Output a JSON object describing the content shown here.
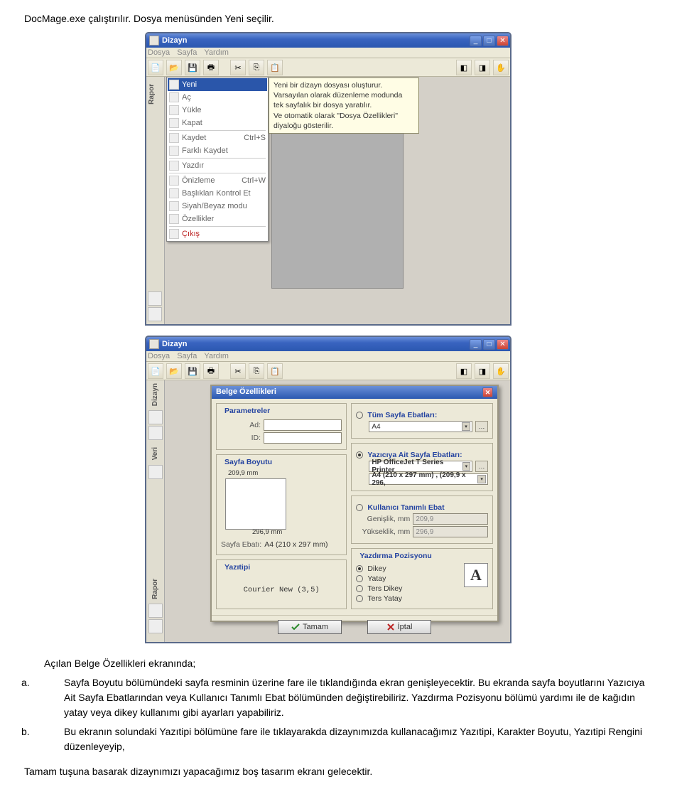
{
  "doc": {
    "intro": "DocMage.exe çalıştırılır. Dosya menüsünden Yeni seçilir.",
    "after1": "Açılan Belge Özellikleri ekranında;",
    "a": "Sayfa Boyutu bölümündeki sayfa resminin üzerine fare ile tıklandığında ekran genişleyecektir. Bu ekranda sayfa boyutlarını Yazıcıya Ait Sayfa Ebatlarından veya Kullanıcı Tanımlı Ebat bölümünden değiştirebiliriz. Yazdırma Pozisyonu bölümü yardımı ile de kağıdın yatay veya dikey kullanımı gibi ayarları yapabiliriz.",
    "b": "Bu ekranın solundaki Yazıtipi bölümüne fare ile tıklayarakda dizaynımızda kullanacağımız Yazıtipi, Karakter Boyutu, Yazıtipi Rengini düzenleyeyip,",
    "last": "Tamam tuşuna basarak dizaynımızı yapacağımız boş tasarım ekranı gelecektir."
  },
  "app": {
    "title": "Dizayn",
    "menus": {
      "dosya": "Dosya",
      "sayfa": "Sayfa",
      "yardim": "Yardım"
    },
    "side": {
      "rapor": "Rapor",
      "dizayn": "Dizayn",
      "veri": "Veri"
    }
  },
  "filemenu": {
    "yeni": "Yeni",
    "ac": "Aç",
    "yukle": "Yükle",
    "kapat": "Kapat",
    "kaydet": "Kaydet",
    "kaydet_sc": "Ctrl+S",
    "farkli": "Farklı Kaydet",
    "yazdir": "Yazdır",
    "onizleme": "Önizleme",
    "onizleme_sc": "Ctrl+W",
    "basliklari": "Başlıkları Kontrol Et",
    "siyah": "Siyah/Beyaz modu",
    "ozellikler": "Özellikler",
    "cikis": "Çıkış"
  },
  "tooltip": {
    "l1": "Yeni bir dizayn dosyası oluşturur.",
    "l2": "Varsayılan olarak düzenleme modunda",
    "l3": "tek sayfalık bir dosya yaratılır.",
    "l4": "Ve otomatik olarak \"Dosya Özellikleri\" diyaloğu gösterilir."
  },
  "dialog": {
    "title": "Belge Özellikleri",
    "params": {
      "title": "Parametreler",
      "ad_lab": "Ad:",
      "id_lab": "ID:"
    },
    "sayfa": {
      "title": "Sayfa Boyutu",
      "w": "209,9 mm",
      "h": "296,9 mm",
      "info_lab": "Sayfa Ebatı:",
      "info_val": "A4 (210 x 297 mm)"
    },
    "yazitipi": {
      "title": "Yazıtipi",
      "font": "Courier New (3,5)"
    },
    "tum": {
      "title": "Tüm Sayfa Ebatları:",
      "combo": "A4"
    },
    "yazici": {
      "title": "Yazıcıya Ait Sayfa Ebatları:",
      "printer": "HP OfficeJet T Series Printer",
      "size": "A4 (210 x 297 mm) ,   (209,9 x 296,"
    },
    "kul": {
      "title": "Kullanıcı Tanımlı Ebat",
      "w_lab": "Genişlik, mm",
      "w_val": "209,9",
      "h_lab": "Yükseklik, mm",
      "h_val": "296,9"
    },
    "poz": {
      "title": "Yazdırma Pozisyonu",
      "opt1": "Dikey",
      "opt2": "Yatay",
      "opt3": "Ters Dikey",
      "opt4": "Ters Yatay"
    },
    "ok": "Tamam",
    "cancel": "İptal"
  }
}
